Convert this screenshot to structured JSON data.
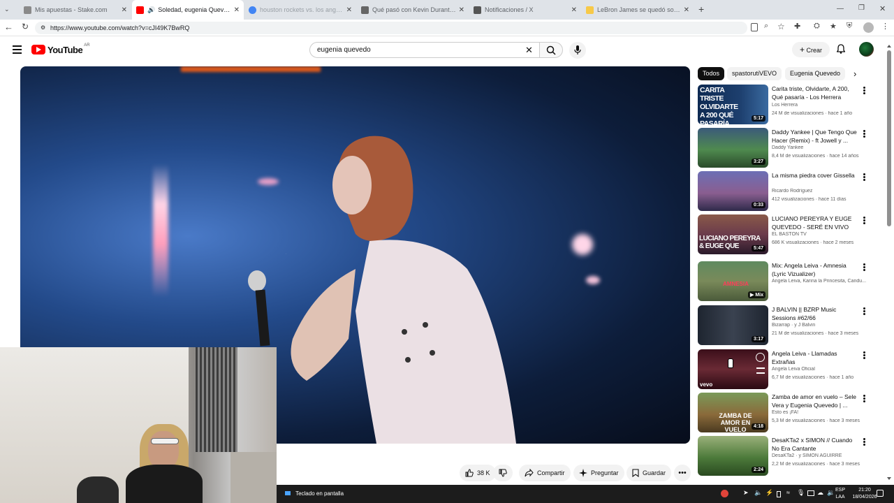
{
  "browser": {
    "tabs": [
      {
        "title": "Mis apuestas - Stake.com",
        "active": false,
        "fav_color": "#1a2c38"
      },
      {
        "title": "Soledad, eugenia Quevedo -",
        "active": true,
        "fav_color": "#ff0000"
      },
      {
        "title": "houston rockets vs. los angeles lak",
        "active": false,
        "fav_color": "#4285f4"
      },
      {
        "title": "Qué pasó con Kevin Durant: baja",
        "active": false,
        "fav_color": "#3b3b3b"
      },
      {
        "title": "Notificaciones / X",
        "active": false,
        "fav_color": "#000000"
      },
      {
        "title": "LeBron James se quedó solo para",
        "active": false,
        "fav_color": "#f7c948"
      }
    ],
    "url": "https://www.youtube.com/watch?v=cJI49K7BwRQ"
  },
  "youtube": {
    "logo_text": "YouTube",
    "logo_region": "AR",
    "search_value": "eugenia quevedo",
    "create_label": "Crear"
  },
  "actions": {
    "likes": "38 K",
    "share": "Compartir",
    "ask": "Preguntar",
    "save": "Guardar"
  },
  "chips": [
    "Todos",
    "spastorutiVEVO",
    "Eugenia Quevedo"
  ],
  "recommendations": [
    {
      "title": "Carita triste, Olvidarte, A 200, Qué pasaría - Los Herrera",
      "channel": "Los Herrera",
      "meta": "24 M de visualizaciones · hace 1 año",
      "duration": "5:17",
      "thumb": "#1d3f6e"
    },
    {
      "title": "Daddy Yankee | Que Tengo Que Hacer (Remix) - ft Jowell y ...",
      "channel": "Daddy Yankee",
      "meta": "8,4 M de visualizaciones · hace 14 años",
      "duration": "3:27",
      "thumb": "#3a6a3a"
    },
    {
      "title": "La misma piedra cover Gissella",
      "channel": "Ricardo Rodríguez",
      "meta": "412 visualizaciones · hace 11 días",
      "duration": "0:33",
      "thumb": "#5b5fa0"
    },
    {
      "title": "LUCIANO PEREYRA Y EUGE QUEVEDO - SERÉ EN VIVO",
      "channel": "EL BASTÓN TV",
      "meta": "686 K visualizaciones · hace 2 meses",
      "duration": "5:47",
      "thumb": "#6b3b4b"
    },
    {
      "title": "Mix: Angela Leiva - Amnesia (Lyric Vizualizer)",
      "channel": "Angela Leiva, Karina la Princesita, Candu...",
      "meta": "",
      "duration": "Mix",
      "thumb": "#6b8a5a"
    },
    {
      "title": "J BALVIN || BZRP Music Sessions #62/66",
      "channel": "Bizarrap · y J Balvin",
      "meta": "21 M de visualizaciones · hace 3 meses",
      "duration": "3:17",
      "thumb": "#2e3440"
    },
    {
      "title": "Angela Leiva - Llamadas Extrañas",
      "channel": "Angela Leiva Oficial",
      "meta": "6,7 M de visualizaciones · hace 1 año",
      "duration": "",
      "thumb": "#5a1f2b"
    },
    {
      "title": "Zamba de amor en vuelo – Sele Vera y Eugenia Quevedo | ...",
      "channel": "Esto es ¡FA!",
      "meta": "5,3 M de visualizaciones · hace 3 meses",
      "duration": "4:18",
      "thumb": "#8a6a3a"
    },
    {
      "title": "DesaKTa2 x SIMON // Cuando No Era Cantante",
      "channel": "DesaKTa2 · y SIMON AGUIRRE",
      "meta": "2,2 M de visualizaciones · hace 3 meses",
      "duration": "2:24",
      "thumb": "#4c7a3a"
    }
  ],
  "thumb_text": {
    "carita": "CARITA TRISTE OLVIDARTE A 200 QUÉ PASARÍA",
    "luciano": "LUCIANO PEREYRA & EUGE QUE",
    "zamba": "ZAMBA DE AMOR EN VUELO",
    "vevo": "vevo",
    "amnesia": "AMNESIA"
  },
  "taskbar": {
    "osk_label": "Teclado en pantalla",
    "lang": "ESP",
    "lang2": "LAA",
    "time": "21:20",
    "date": "18/04/2026"
  }
}
